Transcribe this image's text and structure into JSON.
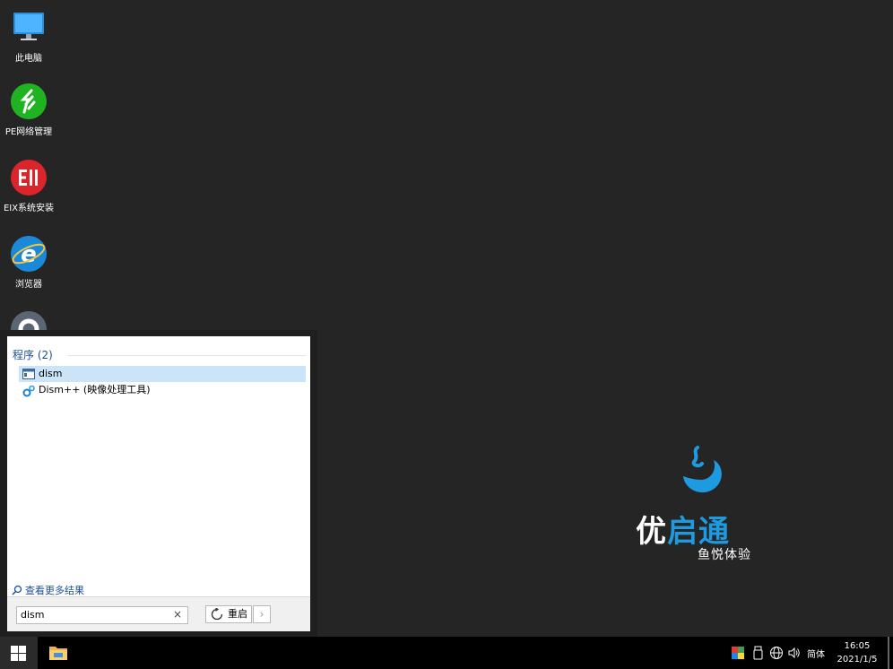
{
  "desktop": {
    "icons": [
      {
        "label": "此电脑",
        "icon": "computer-icon"
      },
      {
        "label": "PE网络管理",
        "icon": "network-manager-icon"
      },
      {
        "label": "EIX系统安装",
        "icon": "eix-install-icon"
      },
      {
        "label": "浏览器",
        "icon": "ie-browser-icon"
      },
      {
        "label": "",
        "icon": "settings-gear-icon"
      }
    ]
  },
  "brand": {
    "name_part1": "优",
    "name_part2": "启通",
    "tagline": "鱼悦体验",
    "accent": "#1e9be0"
  },
  "start_menu": {
    "section_header": "程序 (2)",
    "results": [
      {
        "label": "dism",
        "icon": "app-window-icon",
        "selected": true
      },
      {
        "label": "Dism++ (映像处理工具)",
        "icon": "gears-icon",
        "selected": false
      }
    ],
    "more_results": "查看更多结果",
    "search": {
      "value": "dism",
      "clear": "×"
    },
    "restart_label": "重启",
    "restart_arrow": "›"
  },
  "taskbar": {
    "language": "简体",
    "time": "16:05",
    "date": "2021/1/5"
  }
}
